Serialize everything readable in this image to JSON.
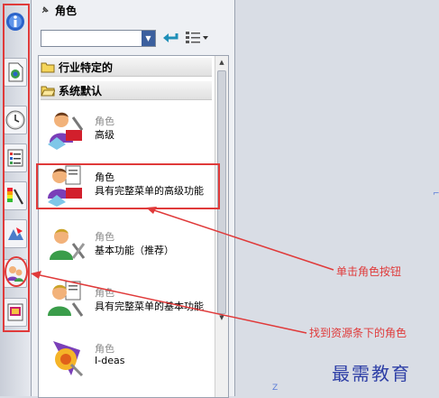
{
  "panel": {
    "title": "角色"
  },
  "groups": [
    {
      "label": "行业特定的",
      "icon": "folder-icon"
    },
    {
      "label": "系统默认",
      "icon": "folder-open-icon"
    }
  ],
  "roles": [
    {
      "category": "角色",
      "name": "高级",
      "icon": "role-advanced-icon"
    },
    {
      "category": "角色",
      "name": "具有完整菜单的高级功能",
      "icon": "role-advanced-full-menu-icon"
    },
    {
      "category": "角色",
      "name": "基本功能（推荐）",
      "icon": "role-essentials-icon"
    },
    {
      "category": "角色",
      "name": "具有完整菜单的基本功能",
      "icon": "role-essentials-full-menu-icon"
    },
    {
      "category": "角色",
      "name": "I-deas",
      "icon": "role-ideas-icon"
    }
  ],
  "resource_bar": [
    "assembly-navigator-icon",
    "part-navigator-icon",
    "history-icon",
    "reuse-library-icon",
    "palette-icon",
    "system-materials-icon",
    "roles-icon",
    "web-browser-icon"
  ],
  "annotations": {
    "click_role": "单击角色按钮",
    "find_role": "找到资源条下的角色",
    "accent": "#e03a3a"
  },
  "watermark": "最需教育"
}
